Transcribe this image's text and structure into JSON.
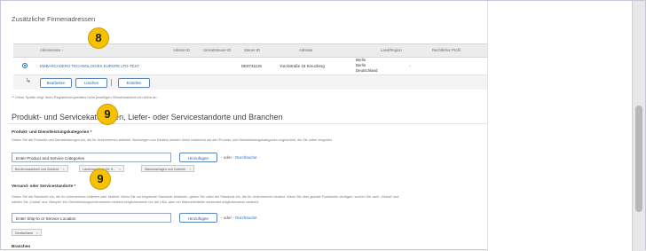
{
  "addresses": {
    "title": "Zusätzliche Firmenadressen",
    "columns": [
      "Adressname ↑",
      "Adress-ID",
      "Umsatzsteuer-ID",
      "Steuer-ID",
      "Adresse",
      "Land/Region",
      "Rechtlicher Profil"
    ],
    "row": {
      "name": "EMBARCADERO TECHNOLOGIES EUROPE LTD-TEST",
      "tax_id": "DE8731129",
      "address": "Yorckstraße 18 Kreuzberg",
      "city1": "Berlin",
      "city2": "Berlin",
      "country": "Deutschland",
      "profile": "-"
    },
    "buttons": {
      "edit": "Bearbeiten",
      "delete": "Löschen",
      "create": "Erstellen"
    },
    "footnote": "** Diese Spalte zeigt Ihren Registrierungsstatus beim jeweiligen Steuerstandort von Ariba an."
  },
  "products": {
    "title": "Produkt- und Servicekategorien, Liefer- oder Servicestandorte und Branchen",
    "categories_label": "Produkt- und Dienstleistungskategorien *",
    "categories_help": "Geben Sie die Produkte und Dienstleistungen ein, die Ihr Unternehmen anbietet. Buchungen von Käufern werden Ihnen basierend auf den Produkt- und Dienstleistungskategorien zugeordnet, die Sie unten eingeben.",
    "categories_input": "Enter Product and Service Categories",
    "add_label": "Hinzufügen",
    "or_text": "- oder -",
    "browse_label": "Durchsuche",
    "tags": [
      "Bordermaschinen und Zubehör",
      "Landmaschinen für H...",
      "Wasseranlagen und Zubehör"
    ],
    "ship_label": "Versand- oder Servicestandorte *",
    "ship_help_1": "Geben Sie die Standorte ein, die Ihr Unternehmen beliefert oder bedient. Wenn Sie nur begrenzte Standorte bedienen, geben Sie unten die Standorte ein, die Ihr Unternehmen bedient. Wenn Sie über globale Funktionen verfügen, suchen Sie nach „Global“ und",
    "ship_help_2": "wählen Sie „Global“ aus. Beispiel: Ein Dienstleistungsunternehmen bedient möglicherweise nur die USA, aber ein Warenhersteller versendet möglicherweise weltweit.",
    "ship_input": "Enter Ship-to or Service Location",
    "ship_tag": "Deutschland",
    "industries_label": "Branchen"
  },
  "markers": [
    "8",
    "9",
    "9"
  ]
}
